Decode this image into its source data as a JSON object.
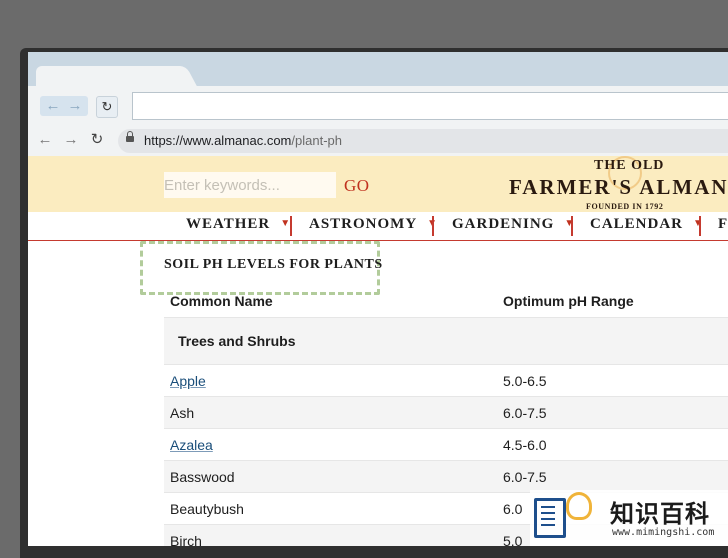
{
  "browser": {
    "back_icon": "back-arrow-icon",
    "forward_icon": "forward-arrow-icon",
    "reload_icon": "reload-icon",
    "url_host": "https://www.almanac.com",
    "url_path": "/plant-ph"
  },
  "site": {
    "search_placeholder": "Enter keywords...",
    "go_label": "GO",
    "logo_top": "THE OLD",
    "logo_main": "FARMER'S ALMANAC",
    "logo_sub": "FOUNDED IN 1792"
  },
  "nav": {
    "items": [
      {
        "label": "WEATHER"
      },
      {
        "label": "ASTRONOMY"
      },
      {
        "label": "GARDENING"
      },
      {
        "label": "CALENDAR"
      },
      {
        "label": "FO"
      }
    ]
  },
  "content": {
    "heading": "SOIL PH LEVELS FOR PLANTS",
    "columns": [
      "Common Name",
      "Optimum pH Range"
    ],
    "group": "Trees and Shrubs",
    "rows": [
      {
        "name": "Apple",
        "range": "5.0-6.5",
        "link": true
      },
      {
        "name": "Ash",
        "range": "6.0-7.5",
        "link": false
      },
      {
        "name": "Azalea",
        "range": "4.5-6.0",
        "link": true
      },
      {
        "name": "Basswood",
        "range": "6.0-7.5",
        "link": false
      },
      {
        "name": "Beautybush",
        "range": "6.0",
        "link": false
      },
      {
        "name": "Birch",
        "range": "5.0",
        "link": false
      }
    ]
  },
  "watermark": {
    "title": "知识百科",
    "url": "www.mimingshi.com"
  },
  "colors": {
    "header_bg": "#fbecc0",
    "accent_red": "#c0321f",
    "link_blue": "#1a4e7a",
    "heading_outline": "#b2cc9b"
  }
}
